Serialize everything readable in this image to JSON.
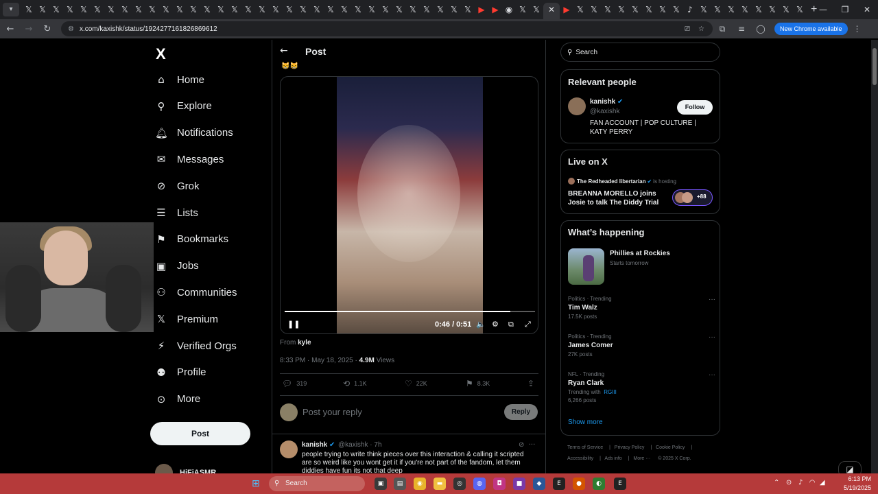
{
  "browser": {
    "url": "x.com/kaxishk/status/1924277161826869612",
    "new_chrome": "New Chrome available"
  },
  "nav": {
    "logo": "X",
    "items": [
      "Home",
      "Explore",
      "Notifications",
      "Messages",
      "Grok",
      "Lists",
      "Bookmarks",
      "Jobs",
      "Communities",
      "Premium",
      "Verified Orgs",
      "Profile",
      "More"
    ],
    "post_button": "Post",
    "account_name": "HiFiASMR"
  },
  "post": {
    "header": "Post",
    "video_time": "0:46 / 0:51",
    "video_progress": 0.9,
    "from_label": "From",
    "from_user": "kyle",
    "timestamp": "8:33 PM · May 18, 2025 · ",
    "views_count": "4.9M",
    "views_label": " Views",
    "replies": "319",
    "reposts": "1.1K",
    "likes": "22K",
    "bookmarks": "8.3K",
    "reply_placeholder": "Post your reply",
    "reply_button": "Reply"
  },
  "reply_tweet": {
    "name": "kanishk",
    "handle": "@kaxishk · 7h",
    "text": "people trying to write think pieces over this interaction & calling it scripted are so weird like you wont get it if you're not part of the fandom, let them diddies have fun its not that deep"
  },
  "sidebar": {
    "search_placeholder": "Search",
    "relevant": {
      "title": "Relevant people",
      "name": "kanishk",
      "handle": "@kaxishk",
      "follow": "Follow",
      "bio": "FAN ACCOUNT | POP CULTURE | KATY PERRY"
    },
    "live": {
      "title": "Live on X",
      "host": "The Redheaded libertarian",
      "hosting": "is hosting",
      "space_title": "BREANNA MORELLO joins Josie to talk The Diddy Trial",
      "listeners": "+88"
    },
    "happening": {
      "title": "What’s happening",
      "event_title": "Phillies at Rockies",
      "event_sub": "Starts tomorrow",
      "trends": [
        {
          "cat": "Politics · Trending",
          "name": "Tim Walz",
          "posts": "17.5K posts"
        },
        {
          "cat": "Politics · Trending",
          "name": "James Comer",
          "posts": "27K posts"
        },
        {
          "cat": "NFL · Trending",
          "name": "Ryan Clark",
          "trending_with": "Trending with",
          "tag": "RGIII",
          "posts": "6,266 posts"
        }
      ],
      "show_more": "Show more"
    },
    "footer": {
      "terms": "Terms of Service",
      "privacy": "Privacy Policy",
      "cookie": "Cookie Policy",
      "accessibility": "Accessibility",
      "ads": "Ads info",
      "more": "More ···",
      "copyright": "© 2025 X Corp."
    }
  },
  "taskbar": {
    "search": "Search",
    "time": "6:13 PM",
    "date": "5/19/2025"
  }
}
